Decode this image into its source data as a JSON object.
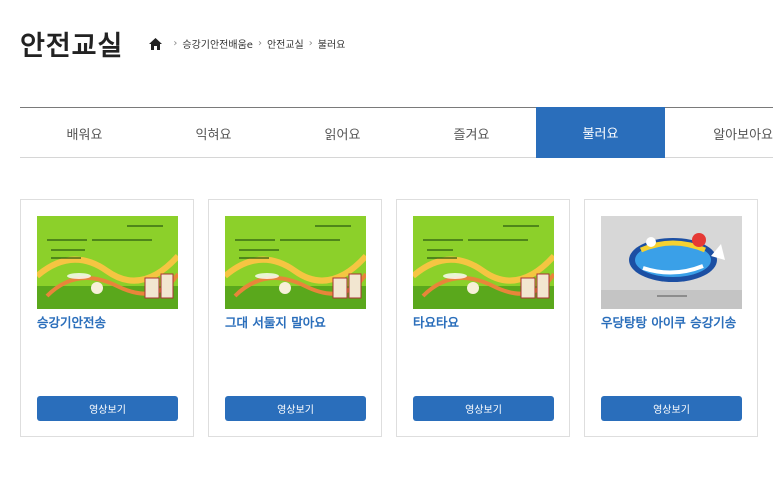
{
  "page_title": "안전교실",
  "breadcrumb": [
    "승강기안전배움e",
    "안전교실",
    "불러요"
  ],
  "tabs": [
    {
      "label": "배워요",
      "active": false
    },
    {
      "label": "익혀요",
      "active": false
    },
    {
      "label": "읽어요",
      "active": false
    },
    {
      "label": "즐겨요",
      "active": false
    },
    {
      "label": "불러요",
      "active": true
    },
    {
      "label": "알아보아요",
      "active": false
    }
  ],
  "cards": [
    {
      "title": "승강기안전송",
      "button_label": "영상보기"
    },
    {
      "title": "그대 서둘지 말아요",
      "button_label": "영상보기"
    },
    {
      "title": "타요타요",
      "button_label": "영상보기"
    },
    {
      "title": "우당탕탕 아이쿠 승강기송",
      "button_label": "영상보기"
    }
  ],
  "colors": {
    "accent": "#2a6ebb",
    "thumb_green": "#8cd02a"
  },
  "icons": {
    "home": "home-icon",
    "separator": "chevron-right-icon"
  }
}
